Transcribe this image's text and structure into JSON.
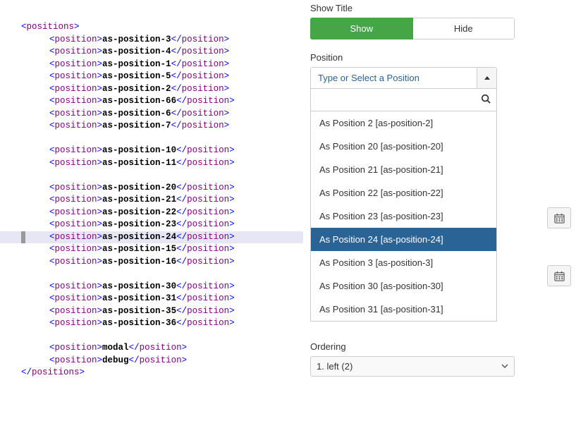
{
  "xml": {
    "root_open": "positions",
    "root_close": "positions",
    "child_tag": "position",
    "groups": [
      [
        "as-position-3",
        "as-position-4",
        "as-position-1",
        "as-position-5",
        "as-position-2",
        "as-position-66",
        "as-position-6",
        "as-position-7"
      ],
      [
        "as-position-10",
        "as-position-11"
      ],
      [
        "as-position-20",
        "as-position-21",
        "as-position-22",
        "as-position-23",
        "as-position-24",
        "as-position-15",
        "as-position-16"
      ],
      [
        "as-position-30",
        "as-position-31",
        "as-position-35",
        "as-position-36"
      ],
      [
        "modal",
        "debug"
      ]
    ],
    "highlighted_value": "as-position-24"
  },
  "right": {
    "show_title": {
      "label": "Show Title",
      "options": [
        "Show",
        "Hide"
      ],
      "active_index": 0
    },
    "position": {
      "label": "Position",
      "placeholder": "Type or Select a Position",
      "search_value": "",
      "dropdown_items": [
        {
          "label": "As Position 2 [as-position-2]",
          "selected": false
        },
        {
          "label": "As Position 20 [as-position-20]",
          "selected": false
        },
        {
          "label": "As Position 21 [as-position-21]",
          "selected": false
        },
        {
          "label": "As Position 22 [as-position-22]",
          "selected": false
        },
        {
          "label": "As Position 23 [as-position-23]",
          "selected": false
        },
        {
          "label": "As Position 24 [as-position-24]",
          "selected": true
        },
        {
          "label": "As Position 3 [as-position-3]",
          "selected": false
        },
        {
          "label": "As Position 30 [as-position-30]",
          "selected": false
        },
        {
          "label": "As Position 31 [as-position-31]",
          "selected": false
        }
      ]
    },
    "ordering": {
      "label": "Ordering",
      "value": "1. left (2)"
    }
  }
}
